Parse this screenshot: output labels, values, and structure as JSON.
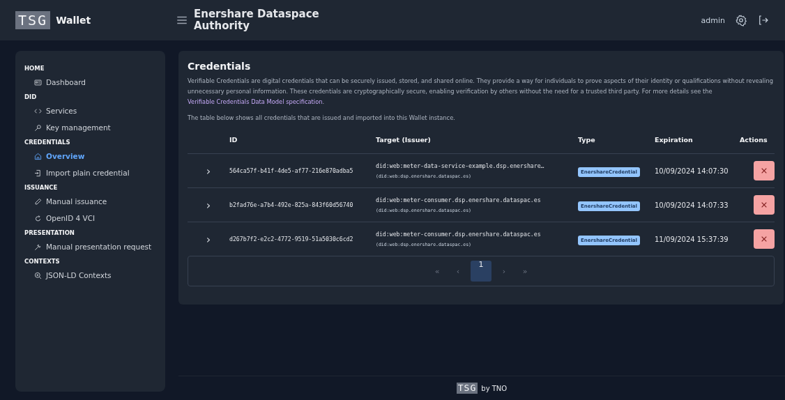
{
  "header": {
    "logo_text": "TSG",
    "app_name": "Wallet",
    "title": "Enershare Dataspace Authority",
    "user": "admin"
  },
  "sidebar": {
    "sections": [
      {
        "title": "HOME",
        "items": [
          {
            "label": "Dashboard",
            "selected": false
          }
        ]
      },
      {
        "title": "DID",
        "items": [
          {
            "label": "Services",
            "selected": false
          },
          {
            "label": "Key management",
            "selected": false
          }
        ]
      },
      {
        "title": "CREDENTIALS",
        "items": [
          {
            "label": "Overview",
            "selected": true
          },
          {
            "label": "Import plain credential",
            "selected": false
          }
        ]
      },
      {
        "title": "ISSUANCE",
        "items": [
          {
            "label": "Manual issuance",
            "selected": false
          },
          {
            "label": "OpenID 4 VCI",
            "selected": false
          }
        ]
      },
      {
        "title": "PRESENTATION",
        "items": [
          {
            "label": "Manual presentation request",
            "selected": false
          }
        ]
      },
      {
        "title": "CONTEXTS",
        "items": [
          {
            "label": "JSON-LD Contexts",
            "selected": false
          }
        ]
      }
    ]
  },
  "main": {
    "title": "Credentials",
    "intro": "Verifiable Credentials are digital credentials that can be securely issued, stored, and shared online. They provide a way for individuals to prove aspects of their identity or qualifications without revealing unnecessary personal information. These credentials are cryptographically secure, enabling verification by others without the need for a trusted third party. For more details see the",
    "intro_link": "Verifiable Credentials Data Model specification",
    "intro_end": ".",
    "note": "The table below shows all credentials that are issued and imported into this Wallet instance.",
    "table": {
      "columns": [
        "ID",
        "Target (Issuer)",
        "Type",
        "Expiration",
        "Actions"
      ],
      "rows": [
        {
          "expand": "›",
          "id": "564ca57f-b41f-4de5-af77-216e870adba5",
          "target": "did:web:meter-data-service-example.dsp.enershare…",
          "issuer": "(did:web:dsp.enershare.dataspac.es)",
          "type": "EnershareCredential",
          "expiration": "10/09/2024 14:07:30"
        },
        {
          "expand": "›",
          "id": "b2fad76e-a7b4-492e-825a-843f60d56740",
          "target": "did:web:meter-consumer.dsp.enershare.dataspac.es",
          "issuer": "(did:web:dsp.enershare.dataspac.es)",
          "type": "EnershareCredential",
          "expiration": "10/09/2024 14:07:33"
        },
        {
          "expand": "›",
          "id": "d267b7f2-e2c2-4772-9519-51a5030c6cd2",
          "target": "did:web:meter-consumer.dsp.enershare.dataspac.es",
          "issuer": "(did:web:dsp.enershare.dataspac.es)",
          "type": "EnershareCredential",
          "expiration": "11/09/2024 15:37:39"
        }
      ]
    },
    "pagination": [
      {
        "label": "«",
        "kind": "nav",
        "selected": false
      },
      {
        "label": "‹",
        "kind": "nav",
        "selected": false
      },
      {
        "label": "1",
        "kind": "page",
        "selected": true
      },
      {
        "label": "›",
        "kind": "nav",
        "selected": false
      },
      {
        "label": "»",
        "kind": "nav",
        "selected": false
      }
    ]
  },
  "footer": {
    "logo_text": "TSG",
    "text": "by TNO"
  }
}
